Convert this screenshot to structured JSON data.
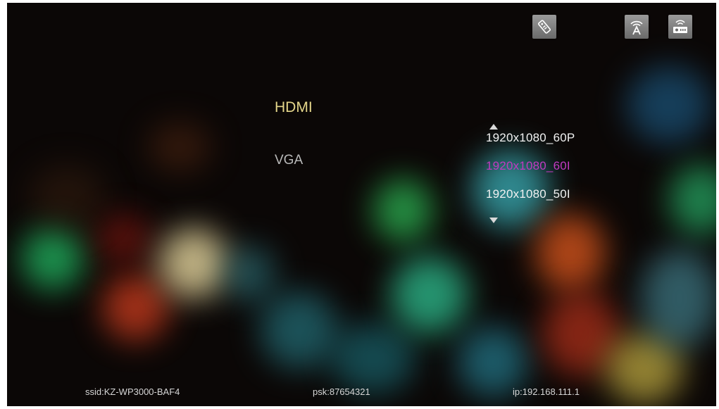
{
  "top_icons": [
    {
      "name": "remote-icon"
    },
    {
      "name": "airplay-icon"
    },
    {
      "name": "wifi-device-icon"
    }
  ],
  "display": {
    "sources": [
      {
        "label": "HDMI",
        "active": true
      },
      {
        "label": "VGA",
        "active": false
      }
    ],
    "resolutions": [
      {
        "label": "1920x1080_60P",
        "selected": false
      },
      {
        "label": "1920x1080_60I",
        "selected": true
      },
      {
        "label": "1920x1080_50I",
        "selected": false
      }
    ]
  },
  "status": {
    "ssid": "ssid:KZ-WP3000-BAF4",
    "psk": "psk:87654321",
    "ip": "ip:192.168.111.1"
  },
  "colors": {
    "background": "#0b0706",
    "active_source": "#e4d58a",
    "inactive_source": "#b9b9b9",
    "selected_resolution": "#c13ac0",
    "resolution_text": "#f1f1f1",
    "status_text": "#d6d6d6"
  }
}
